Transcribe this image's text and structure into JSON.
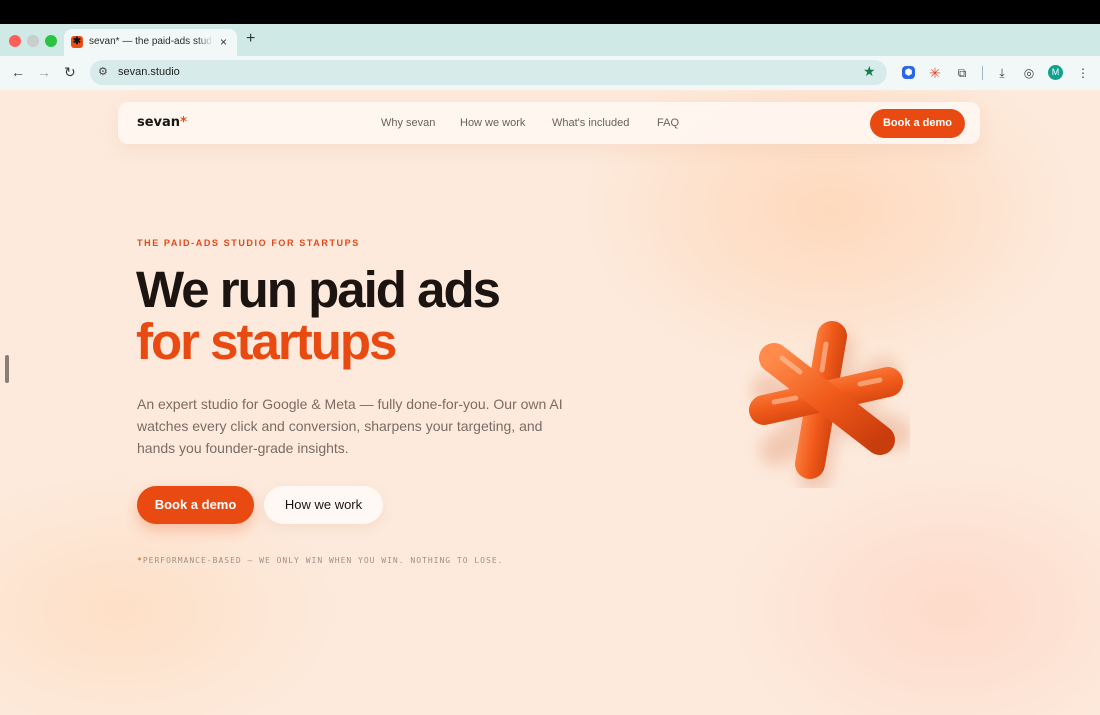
{
  "browser": {
    "tab_title": "sevan* — the paid-ads studio for startups",
    "tab_close": "×",
    "new_tab": "+",
    "url": "sevan.studio",
    "avatar_initial": "M",
    "icons": [
      "back-arrow-icon",
      "forward-arrow-icon",
      "reload-icon",
      "site-settings-icon",
      "bookmark-star-icon",
      "extension-icon",
      "puzzle-icon",
      "download-icon",
      "menu-icon"
    ]
  },
  "nav": {
    "logo": "sevan",
    "logo_mark": "*",
    "links": [
      "Why sevan",
      "How we work",
      "What's included",
      "FAQ"
    ],
    "cta": "Book a demo"
  },
  "hero": {
    "eyebrow": "THE PAID-ADS STUDIO FOR STARTUPS",
    "headline_line1": "We run paid ads",
    "headline_line2": "for startups",
    "subtext": "An expert studio for Google & Meta — fully done-for-you. Our own AI watches every click and conversion, sharpens your targeting, and hands you founder-grade insights.",
    "primary_button": "Book a demo",
    "secondary_button": "How we work",
    "footnote_mark": "*",
    "footnote": "PERFORMANCE-BASED — WE ONLY WIN WHEN YOU WIN. NOTHING TO LOSE."
  },
  "colors": {
    "accent": "#e84a12",
    "dark_text": "#1c1410",
    "background": "#fdeadc"
  }
}
